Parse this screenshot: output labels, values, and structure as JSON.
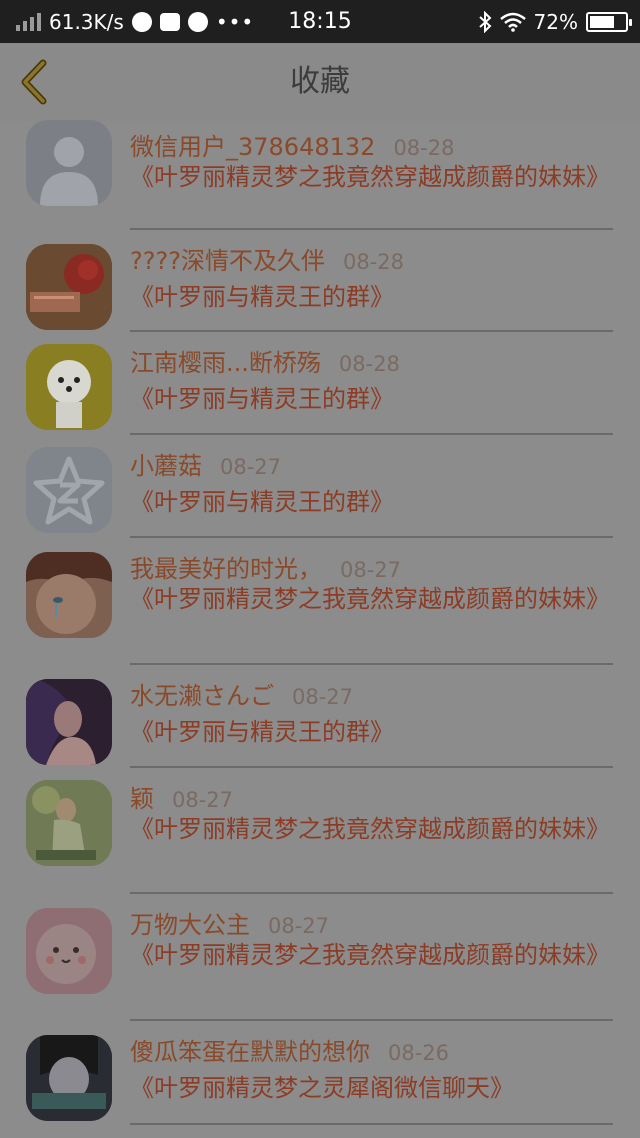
{
  "status_bar": {
    "speed": "61.3K/s",
    "dots": "•••",
    "time": "18:15",
    "battery": "72%"
  },
  "header": {
    "title": "收藏"
  },
  "items": [
    {
      "name": "微信用户_378648132",
      "date": "08-28",
      "group": "《叶罗丽精灵梦之我竟然穿越成颜爵的妹妹》"
    },
    {
      "name": "????深情不及久伴",
      "date": "08-28",
      "group": "《叶罗丽与精灵王的群》"
    },
    {
      "name": "江南樱雨...断桥殇",
      "date": "08-28",
      "group": "《叶罗丽与精灵王的群》"
    },
    {
      "name": "小蘑菇",
      "date": "08-27",
      "group": "《叶罗丽与精灵王的群》"
    },
    {
      "name": "我最美好的时光，",
      "date": "08-27",
      "group": "《叶罗丽精灵梦之我竟然穿越成颜爵的妹妹》"
    },
    {
      "name": "水无濑さんご",
      "date": "08-27",
      "group": "《叶罗丽与精灵王的群》"
    },
    {
      "name": "颖",
      "date": "08-27",
      "group": "《叶罗丽精灵梦之我竟然穿越成颜爵的妹妹》"
    },
    {
      "name": "万物大公主",
      "date": "08-27",
      "group": "《叶罗丽精灵梦之我竟然穿越成颜爵的妹妹》"
    },
    {
      "name": "傻瓜笨蛋在默默的想你",
      "date": "08-26",
      "group": "《叶罗丽精灵梦之灵犀阁微信聊天》"
    }
  ]
}
